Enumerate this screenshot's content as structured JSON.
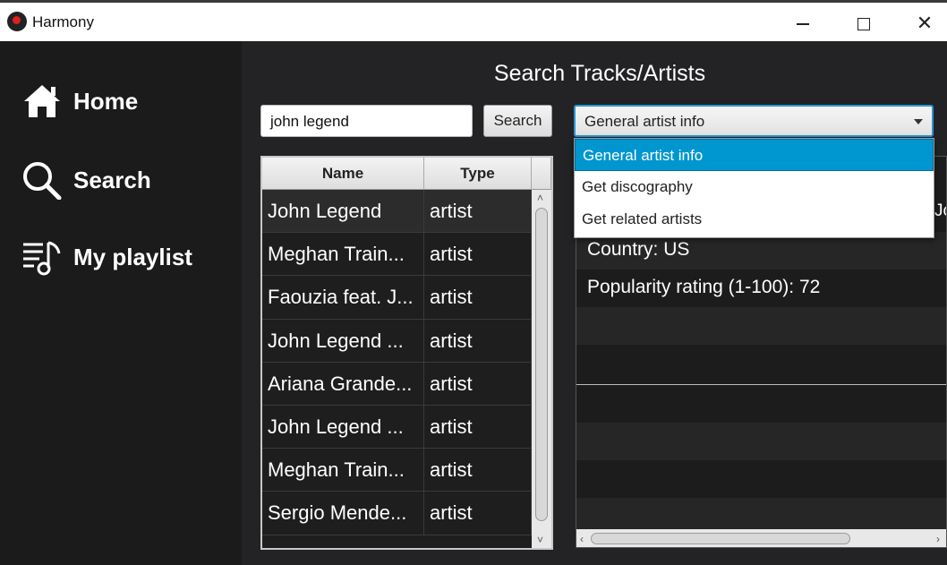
{
  "window": {
    "title": "Harmony",
    "controls": {
      "minimize": "—",
      "maximize": "☐",
      "close": "✕"
    }
  },
  "sidebar": {
    "items": [
      {
        "label": "Home",
        "icon": "home-icon"
      },
      {
        "label": "Search",
        "icon": "search-icon"
      },
      {
        "label": "My playlist",
        "icon": "playlist-icon"
      }
    ]
  },
  "main": {
    "title": "Search Tracks/Artists",
    "search": {
      "value": "john legend",
      "button_label": "Search"
    },
    "dropdown": {
      "selected": "General artist info",
      "options": [
        "General artist info",
        "Get discography",
        "Get related artists"
      ],
      "highlighted_index": 0
    },
    "table": {
      "columns": [
        "Name",
        "Type"
      ],
      "rows": [
        {
          "name": "John Legend",
          "type": "artist"
        },
        {
          "name": "Meghan Train...",
          "type": "artist"
        },
        {
          "name": "Faouzia feat. J...",
          "type": "artist"
        },
        {
          "name": "John Legend ...",
          "type": "artist"
        },
        {
          "name": "Ariana Grande...",
          "type": "artist"
        },
        {
          "name": "John Legend ...",
          "type": "artist"
        },
        {
          "name": "Meghan Train...",
          "type": "artist"
        },
        {
          "name": "Sergio Mende...",
          "type": "artist"
        }
      ]
    },
    "info": {
      "lines": [
        "Country: US",
        "Popularity rating (1-100): 72"
      ],
      "clipped_glyph": "Jc"
    }
  },
  "colors": {
    "accent": "#0096d0",
    "sidebar_bg": "#1b1b1b",
    "main_bg": "#232325"
  }
}
